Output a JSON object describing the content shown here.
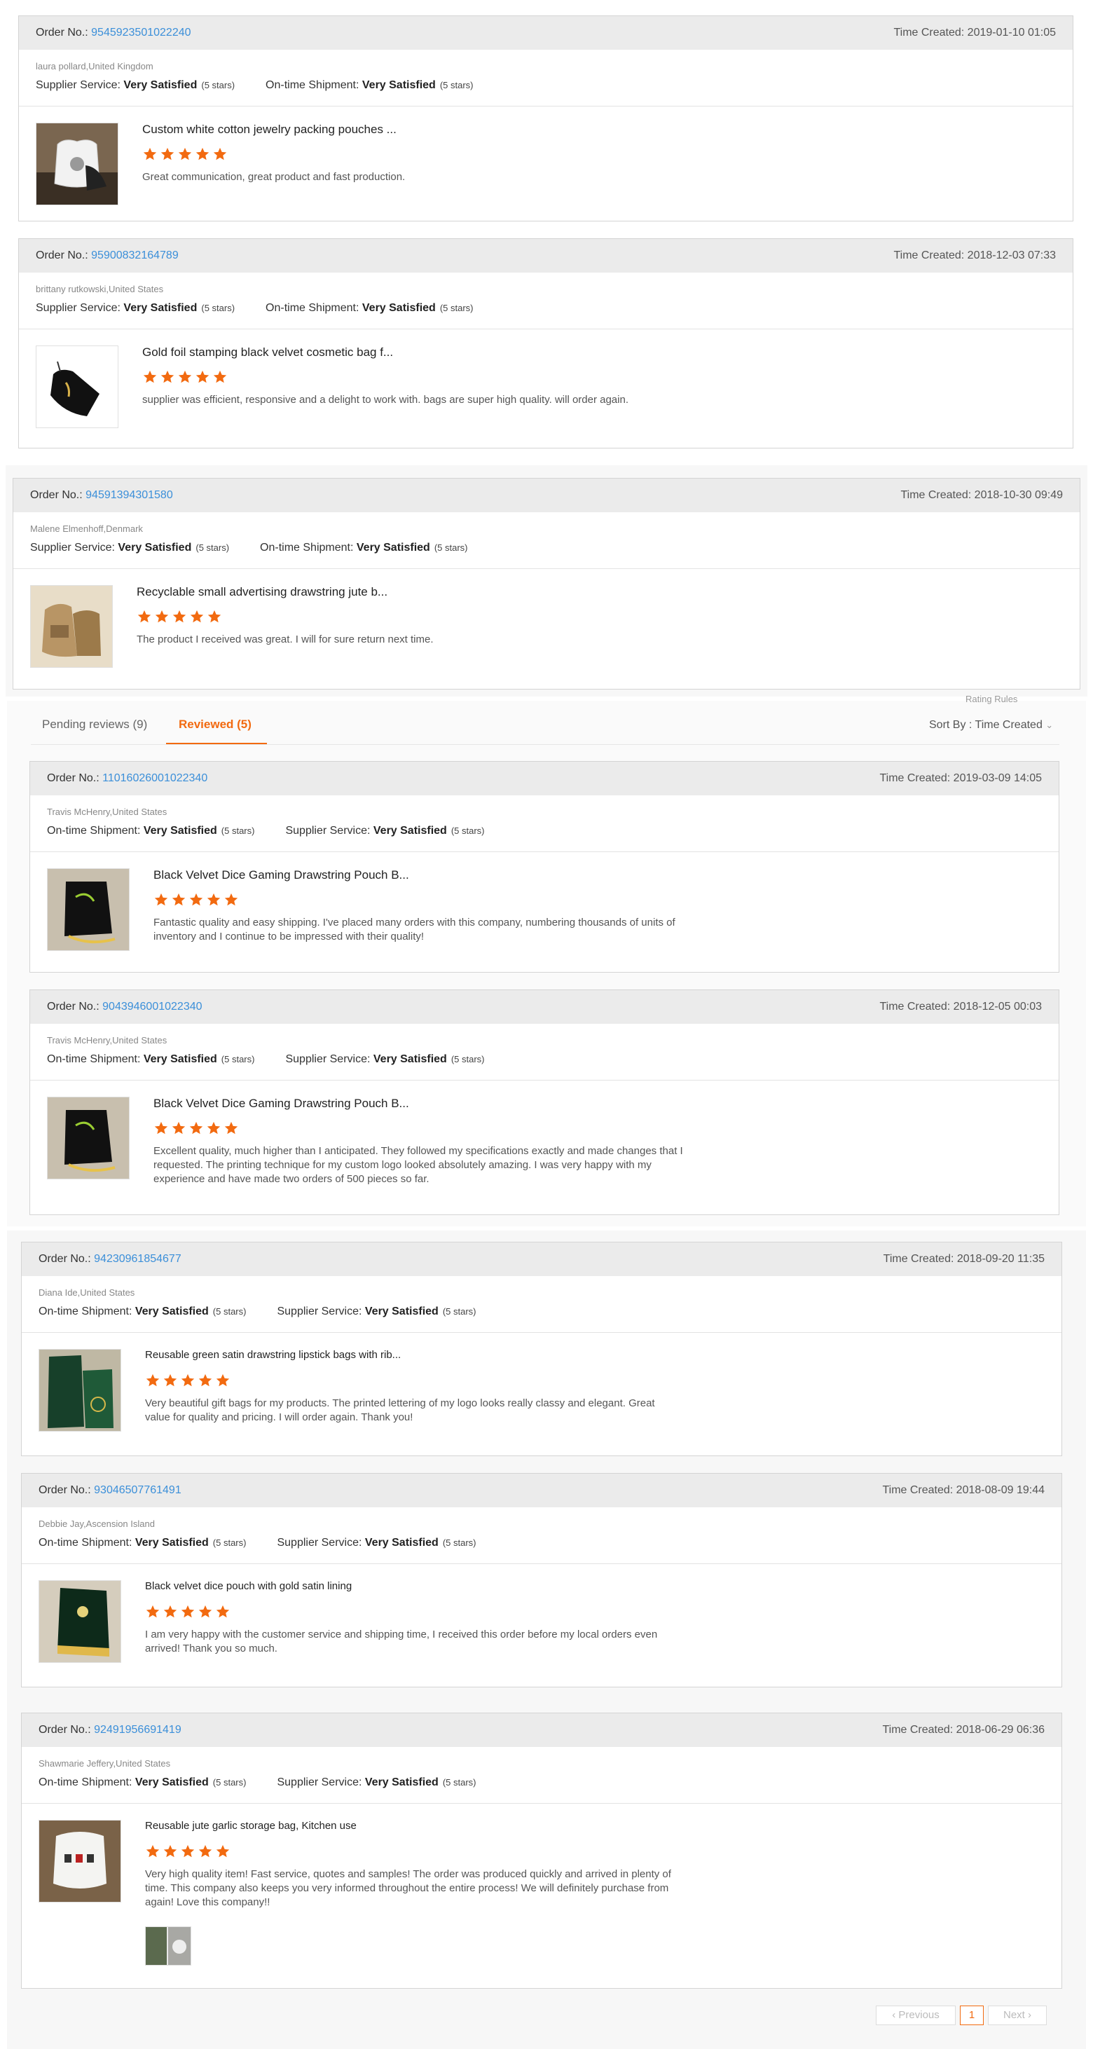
{
  "labels": {
    "order_no": "Order No.:",
    "time_created": "Time Created: ",
    "supplier_service": "Supplier Service:",
    "ontime_shipment": "On-time Shipment:",
    "very_satisfied": "Very Satisfied",
    "five_stars": "(5 stars)"
  },
  "top_orders": [
    {
      "order_no": "9545923501022240",
      "time": "2019-01-10 01:05",
      "buyer": "laura pollard,United Kingdom",
      "product_title": "Custom white cotton jewelry packing pouches ...",
      "review": "Great communication, great product and fast production.",
      "thumb_icon": "white-cotton-pouch-photo",
      "rating": 5
    },
    {
      "order_no": "95900832164789",
      "time": "2018-12-03 07:33",
      "buyer": "brittany rutkowski,United States",
      "product_title": "Gold foil stamping black velvet cosmetic bag f...",
      "review": "supplier was efficient, responsive and a delight to work with. bags are super high quality. will order again.",
      "thumb_icon": "black-velvet-bag-photo",
      "rating": 5
    },
    {
      "order_no": "94591394301580",
      "time": "2018-10-30 09:49",
      "buyer": "Malene Elmenhoff,Denmark",
      "product_title": "Recyclable small advertising drawstring jute b...",
      "review": "The product I received was great. I will for sure return next time.",
      "thumb_icon": "jute-bag-photo",
      "rating": 5
    }
  ],
  "tabs": {
    "pending": "Pending reviews (9)",
    "reviewed": "Reviewed (5)",
    "rating_rules": "Rating Rules",
    "sort_by": "Sort By : Time Created"
  },
  "reviewed_orders": [
    {
      "order_no": "11016026001022340",
      "time": "2019-03-09 14:05",
      "buyer": "Travis McHenry,United States",
      "product_title": "Black Velvet Dice Gaming Drawstring Pouch B...",
      "review": "Fantastic quality and easy shipping.  I've placed many orders with this company, numbering thousands of units of inventory and I continue to be impressed with their quality!",
      "thumb_icon": "black-velvet-dice-pouch-photo",
      "rating": 5
    },
    {
      "order_no": "9043946001022340",
      "time": "2018-12-05 00:03",
      "buyer": "Travis McHenry,United States",
      "product_title": "Black Velvet Dice Gaming Drawstring Pouch B...",
      "review": "Excellent quality, much higher than I anticipated.  They followed my specifications exactly and made changes that I requested.  The printing technique for my custom logo looked absolutely amazing.  I was very happy with my experience and have made two orders of 500 pieces so far.",
      "thumb_icon": "black-velvet-dice-pouch-photo",
      "rating": 5
    }
  ],
  "lower_orders": [
    {
      "order_no": "94230961854677",
      "time": "2018-09-20 11:35",
      "buyer": "Diana Ide,United States",
      "product_title": "Reusable green satin drawstring lipstick bags with rib...",
      "review": "Very beautiful gift bags for my products. The printed lettering of my logo looks really classy and elegant. Great value for quality and pricing. I will order again. Thank you!",
      "thumb_icon": "green-satin-bag-photo",
      "rating": 5
    },
    {
      "order_no": "93046507761491",
      "time": "2018-08-09 19:44",
      "buyer": "Debbie Jay,Ascension Island",
      "product_title": "Black velvet dice pouch with gold satin lining",
      "review": "I am very happy with the customer service and shipping time, I received this order before my local orders even arrived! Thank you so much.",
      "thumb_icon": "velvet-dice-pouch-gold-lining-photo",
      "rating": 5
    },
    {
      "order_no": "92491956691419",
      "time": "2018-06-29 06:36",
      "buyer": "Shawmarie Jeffery,United States",
      "product_title": "Reusable jute garlic storage bag, Kitchen use",
      "review": "Very high quality item! Fast service, quotes and samples! The order was produced quickly and arrived in plenty of time. This company also keeps you very informed throughout the entire process! We will definitely purchase from again! Love this company!!",
      "thumb_icon": "garlic-storage-bag-photo",
      "rating": 5
    }
  ],
  "pagination": {
    "previous": "Previous",
    "page": "1",
    "next": "Next"
  },
  "colors": {
    "link": "#3b8fd9",
    "star": "#f26a10",
    "active_tab": "#f26a10",
    "header_bg": "#ebebeb"
  }
}
